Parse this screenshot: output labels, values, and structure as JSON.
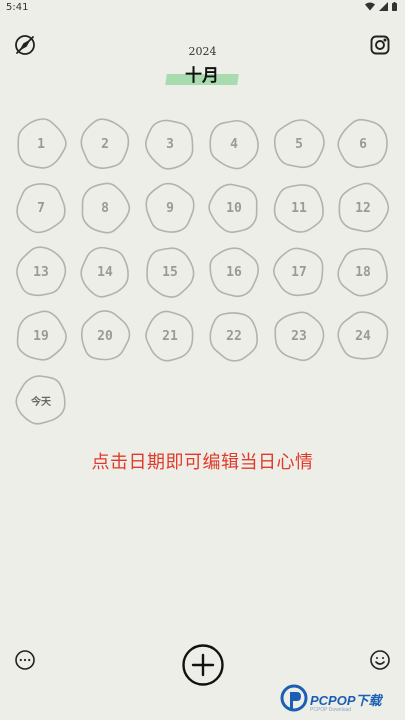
{
  "status_bar": {
    "time": "5:41"
  },
  "header": {
    "year": "2024",
    "month": "十月"
  },
  "calendar": {
    "days": [
      "1",
      "2",
      "3",
      "4",
      "5",
      "6",
      "7",
      "8",
      "9",
      "10",
      "11",
      "12",
      "13",
      "14",
      "15",
      "16",
      "17",
      "18",
      "19",
      "20",
      "21",
      "22",
      "23",
      "24"
    ],
    "today_label": "今天"
  },
  "hint_text": "点击日期即可编辑当日心情",
  "icons": {
    "top_left": "compass-off-icon",
    "top_right": "instagram-icon",
    "bottom_left": "more-icon",
    "bottom_center": "add-icon",
    "bottom_right": "smile-icon"
  },
  "watermark": {
    "brand": "PCPOP下载",
    "sub": "PCPOP Download"
  },
  "colors": {
    "background": "#eeeee8",
    "month_highlight": "#a8dcae",
    "hint": "#e03a2a",
    "day_text": "#9a9a9a"
  }
}
